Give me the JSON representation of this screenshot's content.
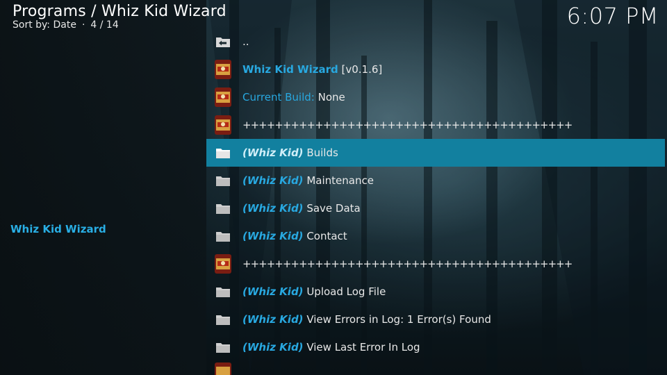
{
  "header": {
    "title": "Programs / Whiz Kid Wizard",
    "sort_label": "Sort by: Date",
    "separator": "·",
    "position": "4 / 14"
  },
  "clock": "6:07 PM",
  "left_panel": {
    "addon_name": "Whiz Kid Wizard"
  },
  "list": {
    "parent": {
      "label": "..",
      "icon": "back-folder-icon"
    },
    "title_row": {
      "name": "Whiz Kid Wizard",
      "version": "[v0.1.6]",
      "icon": "addon-thumbnail-icon"
    },
    "current_build": {
      "key": "Current Build:",
      "value": "None",
      "icon": "addon-thumbnail-icon"
    },
    "separator_1": "+++++++++++++++++++++++++++++++++++++++++",
    "items": [
      {
        "prefix": "(Whiz Kid)",
        "label": "Builds",
        "icon": "folder-icon",
        "focused": true
      },
      {
        "prefix": "(Whiz Kid)",
        "label": "Maintenance",
        "icon": "folder-icon"
      },
      {
        "prefix": "(Whiz Kid)",
        "label": "Save Data",
        "icon": "folder-icon"
      },
      {
        "prefix": "(Whiz Kid)",
        "label": "Contact",
        "icon": "folder-icon"
      }
    ],
    "separator_2": "+++++++++++++++++++++++++++++++++++++++++",
    "items_2": [
      {
        "prefix": "(Whiz Kid)",
        "label": "Upload Log File",
        "icon": "folder-icon"
      },
      {
        "prefix": "(Whiz Kid)",
        "label": "View Errors in Log: 1 Error(s) Found",
        "icon": "folder-icon"
      },
      {
        "prefix": "(Whiz Kid)",
        "label": "View Last Error In Log",
        "icon": "folder-icon"
      }
    ]
  },
  "colors": {
    "accent": "#28a8e0",
    "focus_bg": "#12809f",
    "text": "#e8e8e8"
  }
}
